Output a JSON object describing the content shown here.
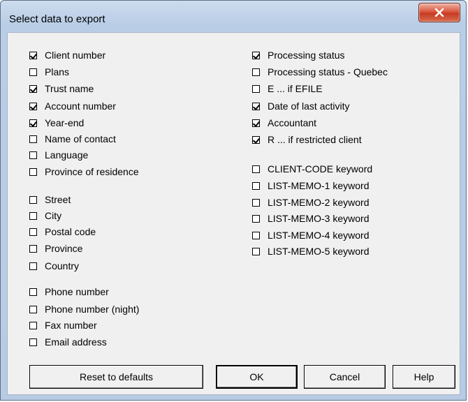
{
  "window": {
    "title": "Select data to export"
  },
  "left_column": [
    {
      "label": "Client number",
      "checked": true
    },
    {
      "label": "Plans",
      "checked": false
    },
    {
      "label": "Trust name",
      "checked": true
    },
    {
      "label": "Account number",
      "checked": true
    },
    {
      "label": "Year-end",
      "checked": true
    },
    {
      "label": "Name of contact",
      "checked": false
    },
    {
      "label": "Language",
      "checked": false
    },
    {
      "label": "Province of residence",
      "checked": false
    },
    {
      "label": "Street",
      "checked": false
    },
    {
      "label": "City",
      "checked": false
    },
    {
      "label": "Postal code",
      "checked": false
    },
    {
      "label": "Province",
      "checked": false
    },
    {
      "label": "Country",
      "checked": false
    },
    {
      "label": "Phone number",
      "checked": false
    },
    {
      "label": "Phone number (night)",
      "checked": false
    },
    {
      "label": "Fax number",
      "checked": false
    },
    {
      "label": "Email address",
      "checked": false
    }
  ],
  "right_column": [
    {
      "label": "Processing status",
      "checked": true
    },
    {
      "label": "Processing status - Quebec",
      "checked": false
    },
    {
      "label": "E ... if EFILE",
      "checked": false
    },
    {
      "label": "Date of last activity",
      "checked": true
    },
    {
      "label": "Accountant",
      "checked": true
    },
    {
      "label": "R ... if restricted client",
      "checked": true
    },
    {
      "label": "CLIENT-CODE keyword",
      "checked": false
    },
    {
      "label": "LIST-MEMO-1 keyword",
      "checked": false
    },
    {
      "label": "LIST-MEMO-2 keyword",
      "checked": false
    },
    {
      "label": "LIST-MEMO-3 keyword",
      "checked": false
    },
    {
      "label": "LIST-MEMO-4 keyword",
      "checked": false
    },
    {
      "label": "LIST-MEMO-5 keyword",
      "checked": false
    }
  ],
  "buttons": {
    "reset": "Reset to defaults",
    "ok": "OK",
    "cancel": "Cancel",
    "help": "Help"
  },
  "icons": {
    "close": "close-icon"
  },
  "colors": {
    "title_bar": "#b9cde6",
    "close_button": "#c63b22",
    "dialog_background": "#f0f0f0"
  }
}
